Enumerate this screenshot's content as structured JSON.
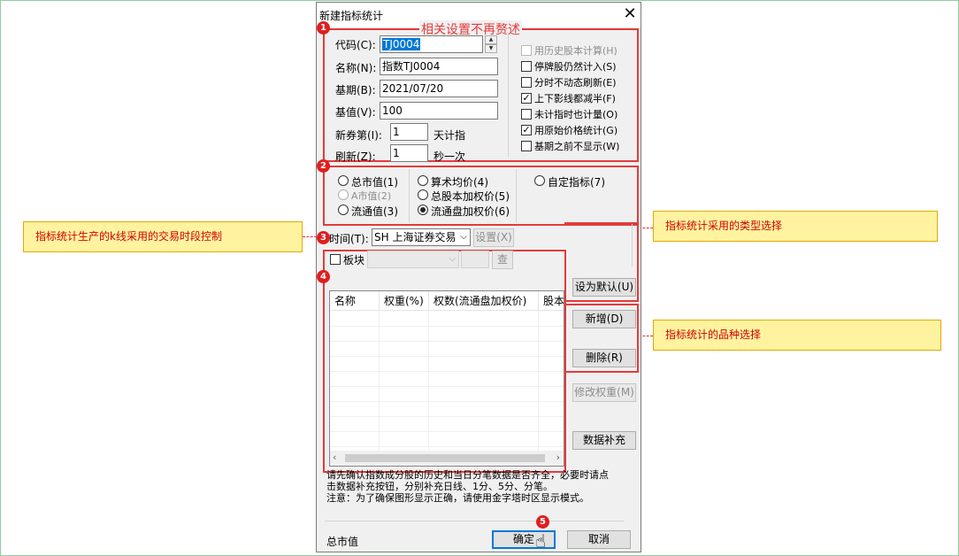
{
  "dialog": {
    "title": "新建指标统计",
    "close_symbol": "✕"
  },
  "annotations": {
    "section1_heading": "相关设置不再赘述",
    "badges": [
      "1",
      "2",
      "3",
      "4",
      "5"
    ],
    "callout_time": "指标统计生产的k线采用的交易时段控制",
    "callout_type": "指标统计采用的类型选择",
    "callout_variety": "指标统计的品种选择"
  },
  "fields": {
    "code_label": "代码(C):",
    "code_value": "TJ0004",
    "name_label": "名称(N):",
    "name_value": "指数TJ0004",
    "base_date_label": "基期(B):",
    "base_date_value": "2021/07/20",
    "base_value_label": "基值(V):",
    "base_value_value": "100",
    "new_stock_label": "新券第(I):",
    "new_stock_value": "1",
    "new_stock_suffix": "天计指",
    "refresh_label": "刷新(Z):",
    "refresh_value": "1",
    "refresh_suffix": "秒一次"
  },
  "options": [
    {
      "label": "用历史股本计算(H)",
      "checked": false,
      "disabled": true
    },
    {
      "label": "停牌股仍然计入(S)",
      "checked": false,
      "disabled": false
    },
    {
      "label": "分时不动态刷新(E)",
      "checked": false,
      "disabled": false
    },
    {
      "label": "上下影线都减半(F)",
      "checked": true,
      "disabled": false
    },
    {
      "label": "未计指时也计量(O)",
      "checked": false,
      "disabled": false
    },
    {
      "label": "用原始价格统计(G)",
      "checked": true,
      "disabled": false
    },
    {
      "label": "基期之前不显示(W)",
      "checked": false,
      "disabled": false
    }
  ],
  "types": {
    "total_mv": "总市值(1)",
    "a_mv": "A市值(2)",
    "float_mv": "流通值(3)",
    "arith_avg": "算术均价(4)",
    "total_cap_weighted": "总股本加权价(5)",
    "float_cap_weighted": "流通盘加权价(6)",
    "custom": "自定指标(7)",
    "selected": "流通盘加权价(6)"
  },
  "time": {
    "label": "时间(T):",
    "value": "SH 上海证券交易",
    "settings_button": "设置(X)"
  },
  "sector": {
    "label": "板块",
    "checked": false,
    "search_button": "查"
  },
  "table": {
    "columns": [
      "名称",
      "权重(%)",
      "权数(流通盘加权价)",
      "股本"
    ]
  },
  "buttons": {
    "set_default": "设为默认(U)",
    "add": "新增(D)",
    "delete": "删除(R)",
    "modify_weight": "修改权重(M)",
    "data_supplement": "数据补充",
    "ok": "确定",
    "cancel": "取消"
  },
  "notes": {
    "line1": "请先确认指数成分股的历史和当日分笔数据是否齐全，必要时请点",
    "line2": "击数据补充按钮，分别补充日线、1分、5分、分笔。",
    "line3": "注意：为了确保图形显示正确，请使用金字塔时区显示模式。"
  },
  "status": {
    "text": "总市值"
  },
  "colors": {
    "annotation_red": "#e33b3b",
    "callout_fill": "#fff3a0",
    "selection_blue": "#0078d7"
  }
}
